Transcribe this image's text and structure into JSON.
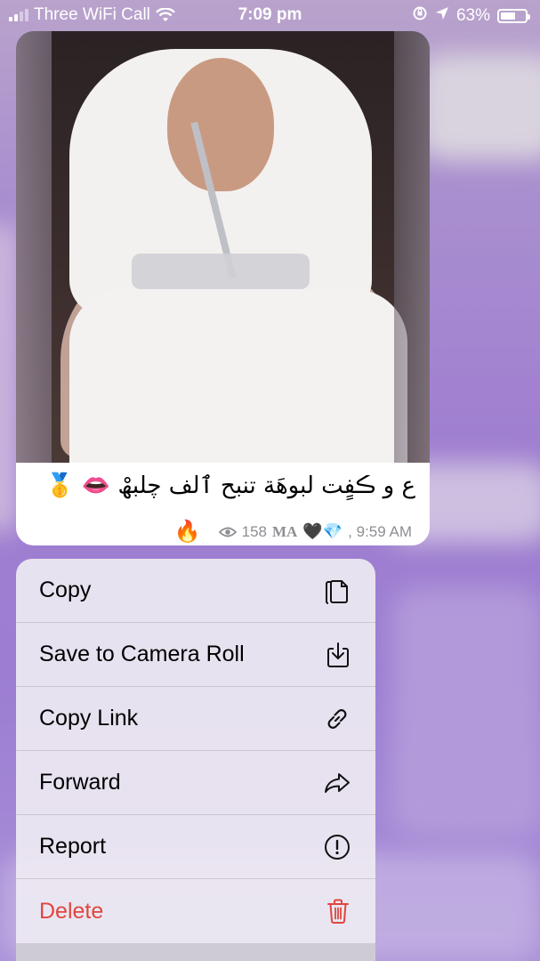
{
  "status_bar": {
    "carrier": "Three WiFi Call",
    "time": "7:09 pm",
    "battery_percent": "63%",
    "battery_level": 0.63
  },
  "message": {
    "caption": "ﻉ و ڪفٍت لبوھَة تنبح ٱلف چلبھْ 👄 🥇",
    "views": "158",
    "signature": "MA",
    "signature_emoji": "🖤💎",
    "time": ", 9:59 AM",
    "fire_emoji": "🔥"
  },
  "context_menu": {
    "items": [
      {
        "label": "Copy",
        "icon": "copy-icon"
      },
      {
        "label": "Save to Camera Roll",
        "icon": "download-icon"
      },
      {
        "label": "Copy Link",
        "icon": "link-icon"
      },
      {
        "label": "Forward",
        "icon": "forward-icon"
      },
      {
        "label": "Report",
        "icon": "exclamation-circle-icon"
      },
      {
        "label": "Delete",
        "icon": "trash-icon",
        "color": "#e0463f"
      }
    ]
  },
  "colors": {
    "accent_delete": "#e0463f",
    "background_purple": "#a07fd0"
  }
}
